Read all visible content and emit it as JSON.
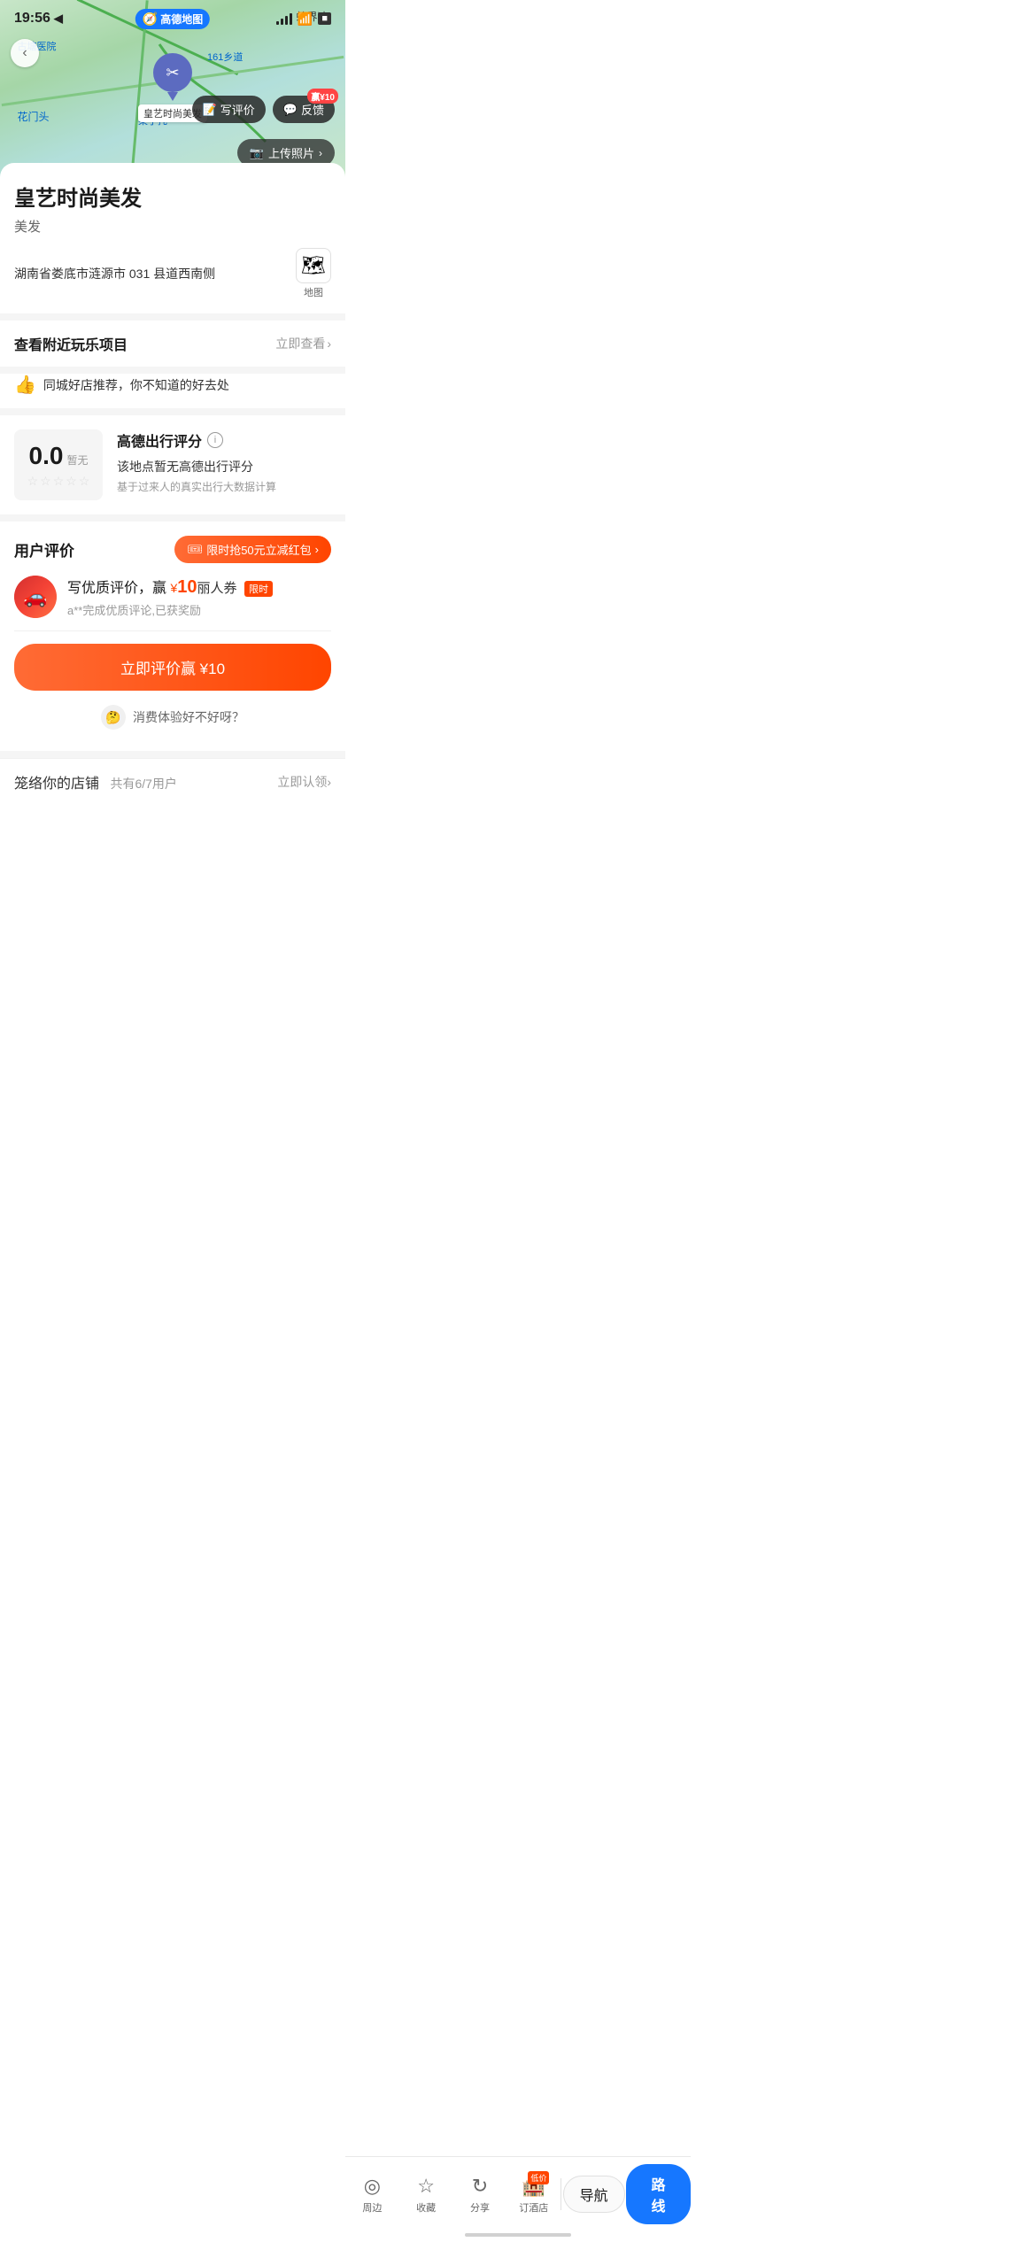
{
  "statusBar": {
    "time": "19:56",
    "locationIcon": "◀",
    "wifiIcon": "wifi"
  },
  "mapHeader": {
    "appName": "高德地图",
    "writeReviewBtn": "写评价",
    "feedbackBtn": "反馈",
    "rewardText": "赢¥10",
    "uploadBtn": "上传照片",
    "pinLabel": "皇艺时尚美发",
    "mapLabels": {
      "label1": "古塘医院",
      "label2": "梨子托",
      "label3": "花门头",
      "road1": "161乡道",
      "loc1": "蛇界冲"
    }
  },
  "shop": {
    "name": "皇艺时尚美发",
    "category": "美发",
    "address": "湖南省娄底市涟源市 031 县道西南侧",
    "mapLabel": "地图"
  },
  "nearby": {
    "title": "查看附近玩乐项目",
    "link": "立即查看",
    "desc": "同城好店推荐，你不知道的好去处"
  },
  "rating": {
    "score": "0.0",
    "tempLabel": "暂无",
    "stars": [
      "☆",
      "☆",
      "☆",
      "☆",
      "☆"
    ],
    "title": "高德出行评分",
    "infoIcon": "i",
    "desc": "该地点暂无高德出行评分",
    "sub": "基于过来人的真实出行大数据计算"
  },
  "userReview": {
    "sectionTitle": "用户评价",
    "couponText": "限时抢50元立减红包",
    "incentivePrefix": "写优质评价，赢",
    "incentiveCurrency": "¥",
    "incentiveAmount": "10",
    "incentiveUnit": "丽人券",
    "limitedBadge": "限时",
    "reviewSub": "a**完成优质评论,已获奖励",
    "ctaBtn": "立即评价赢 ¥10",
    "experienceText": "消费体验好不好呀？"
  },
  "storeSection": {
    "title": "笼络你的店铺",
    "countText": "共有6/7用户",
    "linkText": "立即认领"
  },
  "bottomNav": {
    "items": [
      {
        "icon": "◉",
        "label": "周边"
      },
      {
        "icon": "☆",
        "label": "收藏"
      },
      {
        "icon": "↻",
        "label": "分享"
      },
      {
        "icon": "🏨",
        "label": "订酒店",
        "badge": "低价"
      }
    ],
    "navigateBtn": "导航",
    "routeBtn": "路线"
  }
}
